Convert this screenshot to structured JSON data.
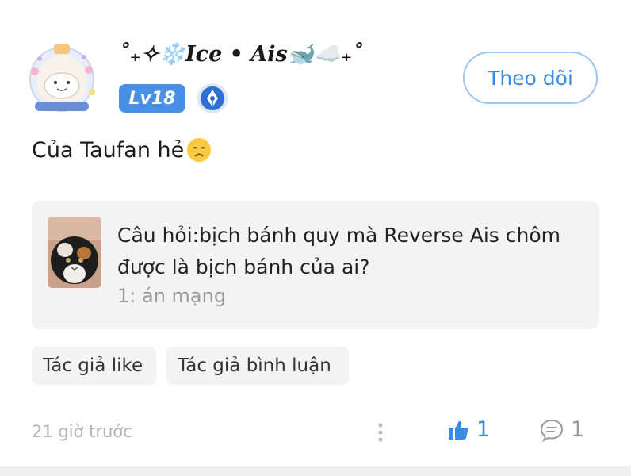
{
  "post": {
    "username": "˚₊✧❄️Ice • Ais🐋☁️₊˚",
    "level": "Lv18",
    "follow_label": "Theo dõi",
    "text": "Của Taufan hẻ",
    "quote": {
      "question": "Câu hỏi:bịch bánh quy mà Reverse Ais chôm được là bịch bánh của ai?",
      "answer": "1: án mạng"
    },
    "tags": [
      "Tác giả like",
      "Tác giả bình luận"
    ],
    "time": "21 giờ trước",
    "likes": "1",
    "comments": "1"
  },
  "colors": {
    "accent": "#3b8be0",
    "level_badge": "#4a8fe6",
    "card_bg": "#f3f3f3",
    "muted_text": "#9a9a9a"
  },
  "icons": [
    "avatar-frame",
    "pen-badge-icon",
    "sad-face-emoji",
    "more-vertical-icon",
    "thumbs-up-icon",
    "comment-bubble-icon"
  ]
}
